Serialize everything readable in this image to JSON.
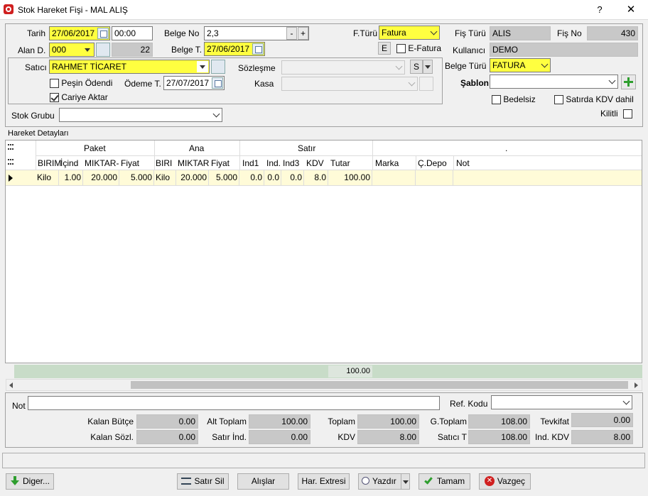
{
  "window": {
    "title": "Stok Hareket Fişi - MAL ALIŞ",
    "help": "?",
    "close": "✕"
  },
  "header": {
    "tarih": {
      "label": "Tarih",
      "value": "27/06/2017",
      "time": "00:00"
    },
    "alan": {
      "label": "Alan D.",
      "value": "000",
      "count": "22"
    },
    "belge_no": {
      "label": "Belge No",
      "value": "2,3",
      "minus": "-",
      "plus": "+"
    },
    "belge_t": {
      "label": "Belge T.",
      "value": "27/06/2017"
    },
    "f_turu": {
      "label": "F.Türü",
      "value": "Fatura"
    },
    "e_btn": "E",
    "e_fatura": "E-Fatura",
    "fis_turu": {
      "label": "Fiş Türü",
      "value": "ALIS"
    },
    "fis_no": {
      "label": "Fiş No",
      "value": "430"
    },
    "kullanici": {
      "label": "Kullanıcı",
      "value": "DEMO"
    },
    "satici": {
      "label": "Satıcı",
      "value": "RAHMET TİCARET"
    },
    "pesin": "Peşin Ödendi",
    "cariye": "Cariye Aktar",
    "odeme": {
      "label": "Ödeme T.",
      "value": "27/07/2017"
    },
    "sozlesme": {
      "label": "Sözleşme",
      "value": "",
      "s": "S"
    },
    "kasa": {
      "label": "Kasa",
      "value": ""
    },
    "belge_turu": {
      "label": "Belge Türü",
      "value": "FATURA"
    },
    "sablon": {
      "label": "Şablon",
      "value": ""
    },
    "bedelsiz": "Bedelsiz",
    "satirda_kdv": "Satırda KDV dahil",
    "kilitli": "Kilitli",
    "stok_grubu": {
      "label": "Stok Grubu",
      "value": ""
    }
  },
  "grid": {
    "caption": "Hareket Detayları",
    "groups": {
      "paket": "Paket",
      "ana": "Ana",
      "satir": "Satır",
      "dot": "."
    },
    "columns": [
      "BIRIM",
      "İçind",
      "MIKTAR-",
      "Fiyat",
      "BIRI",
      "MIKTAR",
      "Fiyat",
      "Ind1",
      "Ind.",
      "Ind3",
      "KDV",
      "Tutar",
      "Marka",
      "Ç.Depo",
      "Not"
    ],
    "rows": [
      [
        "Kilo",
        "1.00",
        "20.000",
        "5.000",
        "Kilo",
        "20.000",
        "5.000",
        "0.0",
        "0.0",
        "0.0",
        "8.0",
        "100.00",
        "",
        "",
        ""
      ]
    ],
    "footer_total": "100.00"
  },
  "summary": {
    "not_label": "Not",
    "not_value": "",
    "ref_label": "Ref. Kodu",
    "ref_value": "",
    "kalan_butce": {
      "label": "Kalan Bütçe",
      "value": "0.00"
    },
    "kalan_sozl": {
      "label": "Kalan Sözl.",
      "value": "0.00"
    },
    "alt_toplam": {
      "label": "Alt Toplam",
      "value": "100.00"
    },
    "satir_ind": {
      "label": "Satır İnd.",
      "value": "0.00"
    },
    "toplam": {
      "label": "Toplam",
      "value": "100.00"
    },
    "kdv": {
      "label": "KDV",
      "value": "8.00"
    },
    "g_toplam": {
      "label": "G.Toplam",
      "value": "108.00"
    },
    "satici_t": {
      "label": "Satıcı T",
      "value": "108.00"
    },
    "tevkifat": {
      "label": "Tevkifat",
      "value": "0.00"
    },
    "ind_kdv": {
      "label": "Ind. KDV",
      "value": "8.00"
    }
  },
  "buttons": {
    "diger": "Diger...",
    "satir_sil": "Satır Sil",
    "alislar": "Alışlar",
    "har_extresi": "Har. Extresi",
    "yazdir": "Yazdır",
    "tamam": "Tamam",
    "vazgec": "Vazgeç"
  },
  "colors": {
    "highlight": "#ffff40",
    "row_selected": "#fffbd8",
    "footer_bar": "#c8dcc8",
    "green": "#2e9e2e",
    "red": "#d02020"
  }
}
